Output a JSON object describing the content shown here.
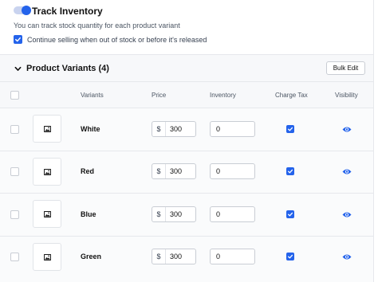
{
  "inventory": {
    "toggle_on": true,
    "title": "Track Inventory",
    "description": "You can track stock quantity for each product variant",
    "continue_checked": true,
    "continue_label": "Continue selling when out of stock or before it's released"
  },
  "variants_section": {
    "title": "Product Variants (4)",
    "bulk_edit_label": "Bulk Edit"
  },
  "table": {
    "headers": {
      "variants": "Variants",
      "price": "Price",
      "inventory": "Inventory",
      "charge_tax": "Charge Tax",
      "visibility": "Visibility"
    },
    "rows": [
      {
        "name": "White",
        "currency": "$",
        "price": "300",
        "inventory": "0",
        "charge_tax": true,
        "visible": true
      },
      {
        "name": "Red",
        "currency": "$",
        "price": "300",
        "inventory": "0",
        "charge_tax": true,
        "visible": true
      },
      {
        "name": "Blue",
        "currency": "$",
        "price": "300",
        "inventory": "0",
        "charge_tax": true,
        "visible": true
      },
      {
        "name": "Green",
        "currency": "$",
        "price": "300",
        "inventory": "0",
        "charge_tax": true,
        "visible": true
      }
    ]
  },
  "icons": {
    "toggle": "toggle-switch-icon",
    "check": "checkmark-icon",
    "chevron": "chevron-down-icon",
    "image": "image-placeholder-icon",
    "eye": "eye-icon"
  },
  "colors": {
    "accent": "#2463eb",
    "border": "#c9cdd4",
    "header_bg": "#f7f8fa"
  }
}
